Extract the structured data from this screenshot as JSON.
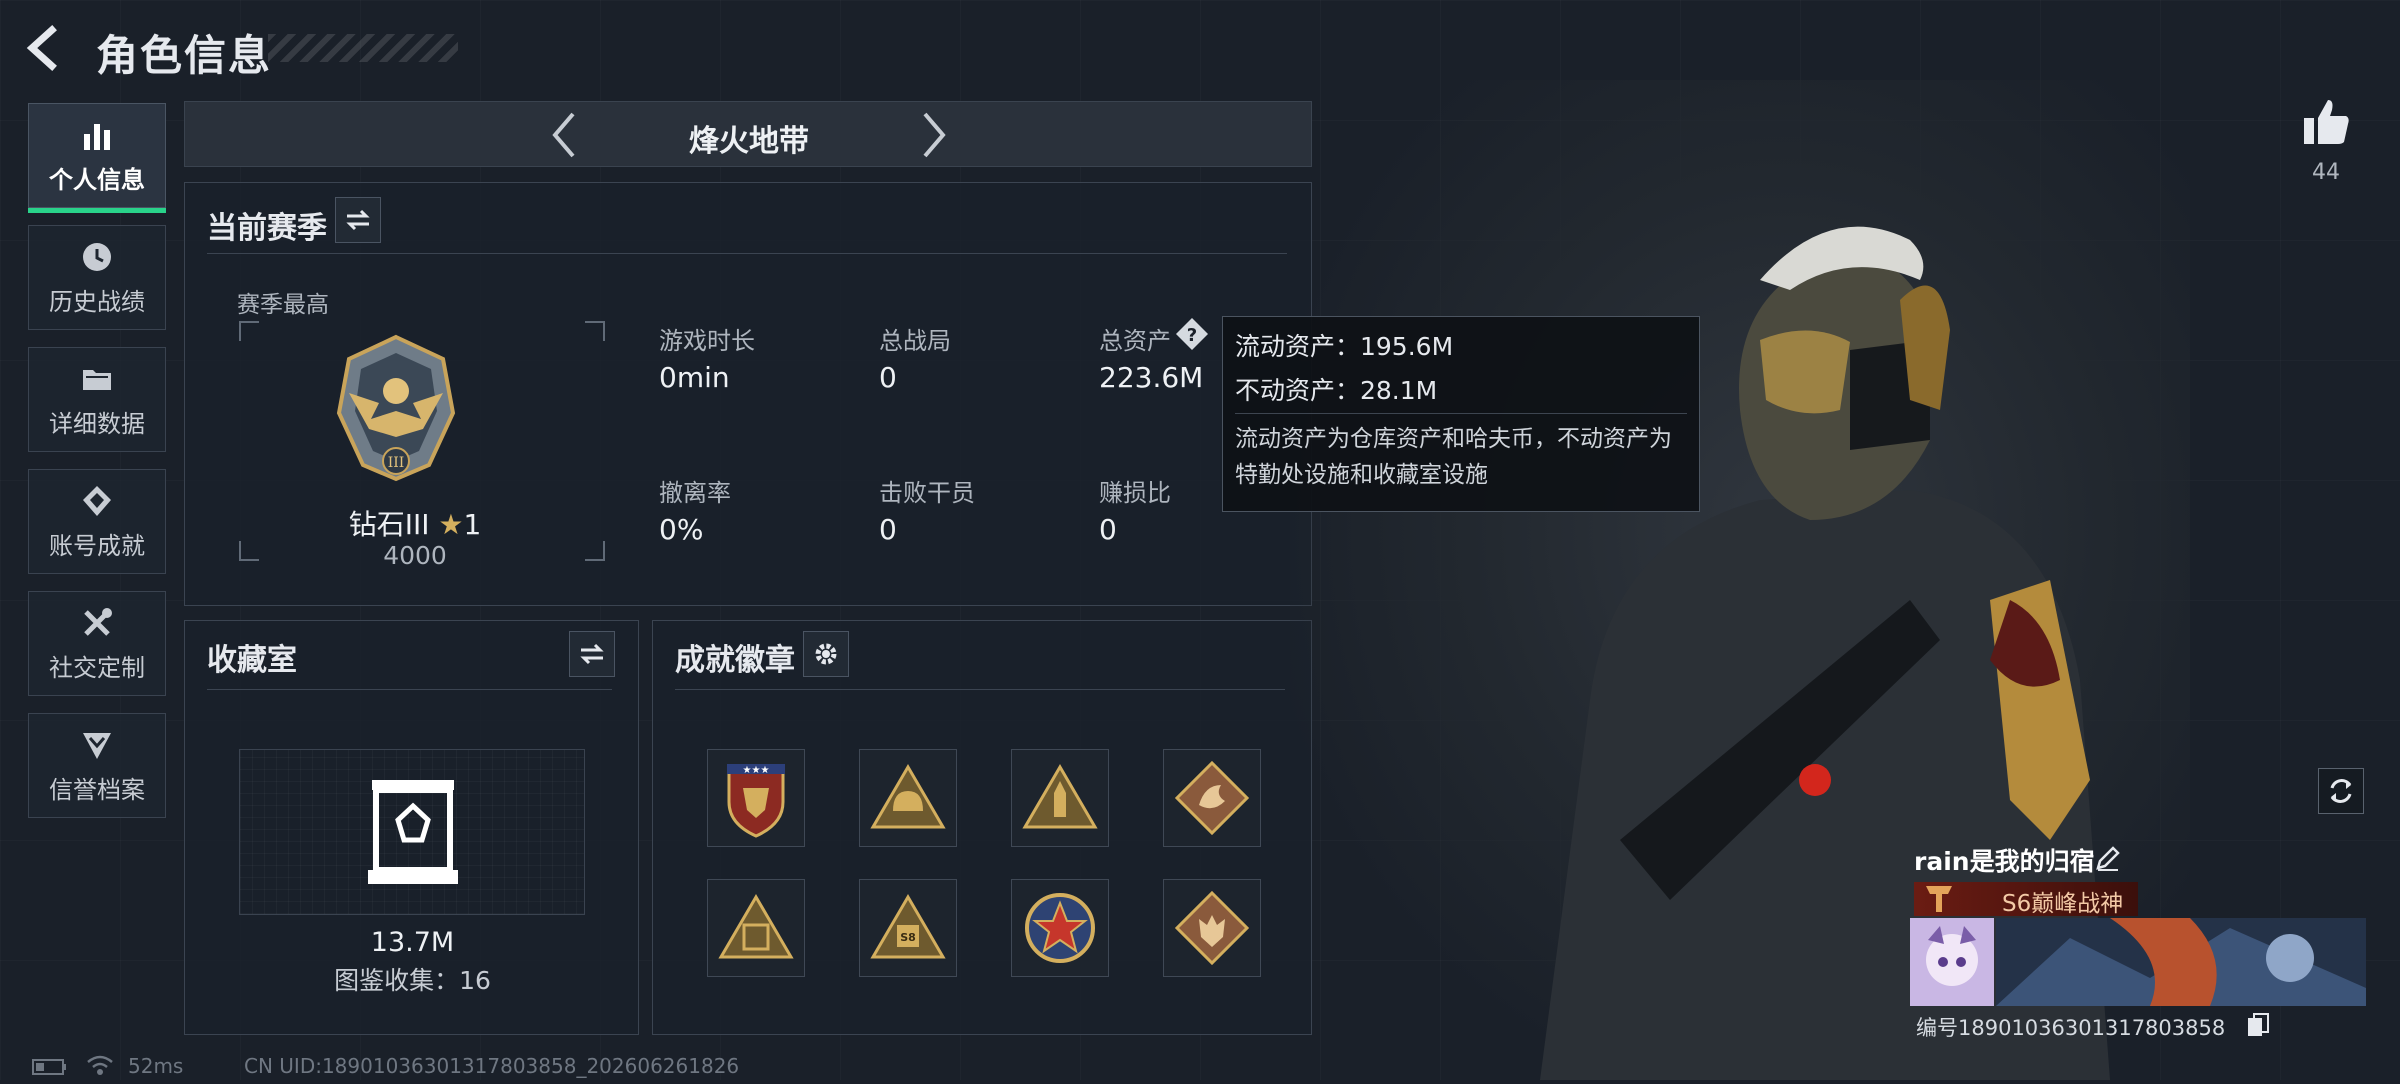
{
  "header": {
    "title": "角色信息"
  },
  "sidebar": {
    "items": [
      {
        "label": "个人信息",
        "icon": "bar-chart-icon",
        "active": true
      },
      {
        "label": "历史战绩",
        "icon": "clock-icon",
        "active": false
      },
      {
        "label": "详细数据",
        "icon": "folder-icon",
        "active": false
      },
      {
        "label": "账号成就",
        "icon": "achievement-icon",
        "active": false
      },
      {
        "label": "社交定制",
        "icon": "tools-icon",
        "active": false
      },
      {
        "label": "信誉档案",
        "icon": "shield-chevron-icon",
        "active": false
      }
    ]
  },
  "mode": {
    "title": "烽火地带"
  },
  "season": {
    "title": "当前赛季",
    "best_label": "赛季最高",
    "rank_name": "钻石III",
    "rank_stars": "1",
    "rank_score": "4000",
    "stats": [
      {
        "label": "游戏时长",
        "value": "0min"
      },
      {
        "label": "总战局",
        "value": "0"
      },
      {
        "label": "总资产",
        "value": "223.6M"
      },
      {
        "label": "撤离率",
        "value": "0%"
      },
      {
        "label": "击败干员",
        "value": "0"
      },
      {
        "label": "赚损比",
        "value": "0"
      }
    ]
  },
  "tooltip": {
    "liquid": "流动资产：195.6M",
    "fixed": "不动资产：28.1M",
    "description": "流动资产为仓库资产和哈夫币，不动资产为特勤处设施和收藏室设施"
  },
  "collection": {
    "title": "收藏室",
    "value": "13.7M",
    "catalog": "图鉴收集：16"
  },
  "badges": {
    "title": "成就徽章",
    "items": [
      "badge-shield-stars",
      "badge-triangle-helmet",
      "badge-triangle-rocket",
      "badge-diamond-dragon",
      "badge-triangle-box",
      "badge-triangle-s8",
      "badge-round-star",
      "badge-diamond-wolf"
    ]
  },
  "player": {
    "likes": "44",
    "name": "rain是我的归宿",
    "rank_title": "S6巅峰战神",
    "id": "编号1890103630131780385​8"
  },
  "status_bar": {
    "ping": "52ms",
    "uid": "CN UID:18901036301317803858_202606261826"
  },
  "colors": {
    "accent_green": "#29d38a",
    "background": "#1a2029",
    "gold": "#c9a45a"
  }
}
